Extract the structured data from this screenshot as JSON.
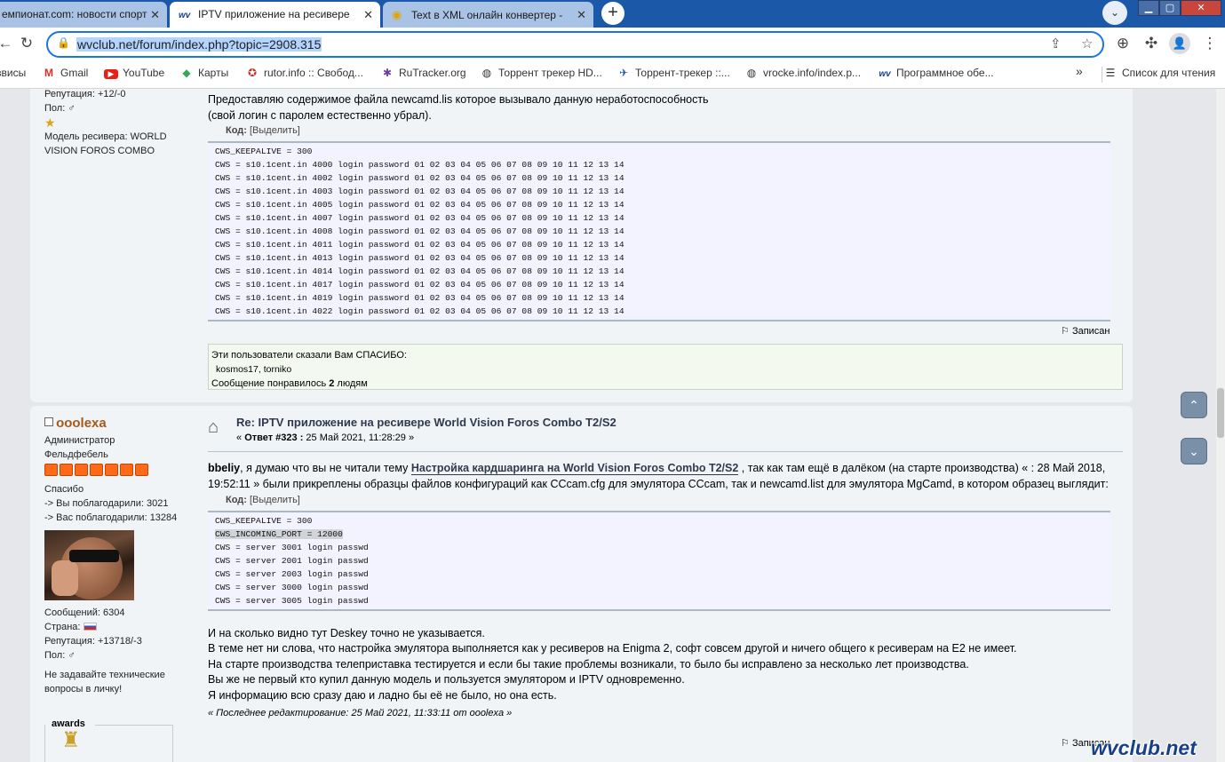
{
  "browser": {
    "tabs": [
      {
        "title": "емпионат.com: новости спорт",
        "active": false
      },
      {
        "title": "IPTV приложение на ресивере",
        "active": true,
        "favicon": "wv"
      },
      {
        "title": "Text в XML онлайн конвертер -",
        "active": false
      }
    ],
    "url": "wvclub.net/forum/index.php?topic=2908.315",
    "bookmarks": [
      {
        "label": "звисы",
        "icon": ""
      },
      {
        "label": "Gmail",
        "icon": "gmail-icon"
      },
      {
        "label": "YouTube",
        "icon": "youtube-icon"
      },
      {
        "label": "Карты",
        "icon": "maps-icon"
      },
      {
        "label": "rutor.info :: Свобод...",
        "icon": "rutor-icon"
      },
      {
        "label": "RuTracker.org",
        "icon": "rutracker-icon"
      },
      {
        "label": "Торрент трекер HD...",
        "icon": "globe-icon"
      },
      {
        "label": "Торрент-трекер ::...",
        "icon": "tracker-icon"
      },
      {
        "label": "vrocke.info/index.p...",
        "icon": "globe-icon"
      },
      {
        "label": "Программное обе...",
        "icon": "wv-icon"
      }
    ],
    "bookmarks_more": "»",
    "reading_list": "Список для чтения",
    "accent": "#1a73e8"
  },
  "post1": {
    "sidebar": {
      "reputation": "Репутация: +12/-0",
      "gender": "Пол: ♂",
      "receiver_model": "Модель ресивера: WORLD VISION FOROS COMBO"
    },
    "text_line1": "Предоставляю содержимое файла newcamd.lis которое вызывало данную неработоспособность",
    "text_line2": "(свой логин с паролем естественно убрал).",
    "code_label": "Код:",
    "code_select": "[Выделить]",
    "code_lines": [
      "CWS_KEEPALIVE = 300",
      "CWS = s10.1cent.in 4000 login password 01 02 03 04 05 06 07 08 09 10 11 12 13 14",
      "CWS = s10.1cent.in 4002 login password 01 02 03 04 05 06 07 08 09 10 11 12 13 14",
      "CWS = s10.1cent.in 4003 login password 01 02 03 04 05 06 07 08 09 10 11 12 13 14",
      "CWS = s10.1cent.in 4005 login password 01 02 03 04 05 06 07 08 09 10 11 12 13 14",
      "CWS = s10.1cent.in 4007 login password 01 02 03 04 05 06 07 08 09 10 11 12 13 14",
      "CWS = s10.1cent.in 4008 login password 01 02 03 04 05 06 07 08 09 10 11 12 13 14",
      "CWS = s10.1cent.in 4011 login password 01 02 03 04 05 06 07 08 09 10 11 12 13 14",
      "CWS = s10.1cent.in 4013 login password 01 02 03 04 05 06 07 08 09 10 11 12 13 14",
      "CWS = s10.1cent.in 4014 login password 01 02 03 04 05 06 07 08 09 10 11 12 13 14",
      "CWS = s10.1cent.in 4017 login password 01 02 03 04 05 06 07 08 09 10 11 12 13 14",
      "CWS = s10.1cent.in 4019 login password 01 02 03 04 05 06 07 08 09 10 11 12 13 14",
      "CWS = s10.1cent.in 4022 login password 01 02 03 04 05 06 07 08 09 10 11 12 13 14"
    ],
    "report_label": "Записан",
    "thanks_header": "Эти пользователи сказали Вам СПАСИБО:",
    "thanks_users": "kosmos17, torniko",
    "likes_prefix": "Сообщение понравилось ",
    "likes_count": "2",
    "likes_suffix": " людям"
  },
  "post2": {
    "sidebar": {
      "username": "ooolexa",
      "role": "Администратор",
      "rank": "Фельдфебель",
      "stars_count": 7,
      "thanks_title": "Спасибо",
      "thanked": "-> Вы поблагодарили: 3021",
      "thanked_by": "-> Вас поблагодарили: 13284",
      "messages": "Сообщений: 6304",
      "country": "Страна:",
      "reputation": "Репутация: +13718/-3",
      "gender": "Пол: ♂",
      "note": "Не задавайте технические вопросы в личку!",
      "awards": "awards"
    },
    "title": "Re: IPTV приложение на ресивере World Vision Foros Combo T2/S2",
    "meta_prefix": "« ",
    "meta_reply": "Ответ #323 :",
    "meta_date": " 25 Май 2021, 11:28:29 »",
    "para1_user": "bbeliy",
    "para1_a": ", я думаю что вы не читали тему ",
    "para1_link": "Настройка кардшаринга на World Vision Foros Combo T2/S2",
    "para1_b": " , так как там ещё в далёком (на старте производства) « : 28 Май 2018, 19:52:11 » были прикреплены образцы файлов конфигураций как CCcam.cfg для эмулятора CCcam, так и newcamd.list для эмулятора MgCamd, в котором образец выглядит:",
    "code_label": "Код:",
    "code_select": "[Выделить]",
    "code_lines": [
      "CWS_KEEPALIVE = 300",
      "CWS_INCOMING_PORT = 12000",
      "CWS = server 3001 login passwd",
      "CWS = server 2001 login passwd",
      "CWS = server 2003 login passwd",
      "CWS = server 3000 login passwd",
      "CWS = server 3005 login passwd"
    ],
    "para2_lines": [
      "И на сколько видно тут Deskey точно не указывается.",
      "В теме нет ни слова, что настройка эмулятора выполняется как у ресиверов на Enigma 2, софт совсем другой и ничего общего к ресиверам на E2 не имеет.",
      "На старте производства телеприставка тестируется и если бы такие проблемы возникали, то было бы исправлено за несколько лет производства.",
      "Вы же не первый кто купил данную модель и пользуется эмулятором и IPTV одновременно.",
      "Я информацию всю сразу даю и ладно бы её не было, но она есть."
    ],
    "last_edit": "« Последнее редактирование: 25 Май 2021, 11:33:11 от ooolexa »",
    "report_label": "Записан"
  },
  "watermark": "wvclub.net"
}
